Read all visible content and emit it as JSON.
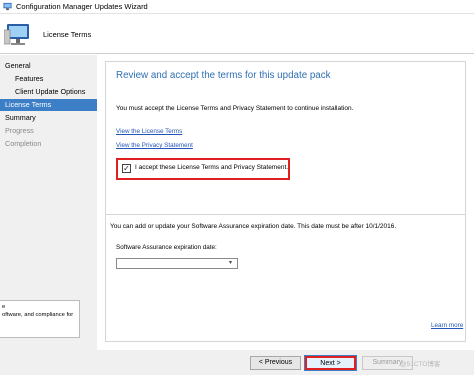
{
  "window": {
    "title": "Configuration Manager Updates Wizard",
    "icon": "wizard-app-icon"
  },
  "banner": {
    "title": "License Terms",
    "icon": "computer-monitor-icon"
  },
  "sidebar": {
    "items": [
      {
        "label": "General",
        "level": 0,
        "state": "normal"
      },
      {
        "label": "Features",
        "level": 1,
        "state": "normal"
      },
      {
        "label": "Client Update Options",
        "level": 1,
        "state": "normal"
      },
      {
        "label": "License Terms",
        "level": 0,
        "state": "active"
      },
      {
        "label": "Summary",
        "level": 0,
        "state": "normal"
      },
      {
        "label": "Progress",
        "level": 0,
        "state": "disabled"
      },
      {
        "label": "Completion",
        "level": 0,
        "state": "disabled"
      }
    ],
    "tooltip_lines": [
      "e",
      "oftware, and compliance for"
    ]
  },
  "main": {
    "heading": "Review and accept the terms for this update pack",
    "instruction": "You must accept the License Terms and Privacy Statement to continue installation.",
    "links": {
      "license_terms": "View the License Terms",
      "privacy_statement": "View the Privacy Statement"
    },
    "accept": {
      "label": "I accept these License Terms and Privacy Statement.",
      "checked": true,
      "check_glyph": "✓"
    },
    "software_assurance": {
      "description": "You can add or update your Software Assurance expiration date. This date must be after 10/1/2016.",
      "field_label": "Software Assurance expiration date:",
      "value": "",
      "dropdown_glyph": "▾"
    },
    "learn_more": "Learn more"
  },
  "footer": {
    "previous_label": "< Previous",
    "next_label": "Next >",
    "summary_label": "Summary",
    "watermark": "@51CTO博客"
  },
  "colors": {
    "accent": "#3c7fc6",
    "heading": "#2f6fb3",
    "link": "#2356b8",
    "highlight": "#e02020"
  }
}
